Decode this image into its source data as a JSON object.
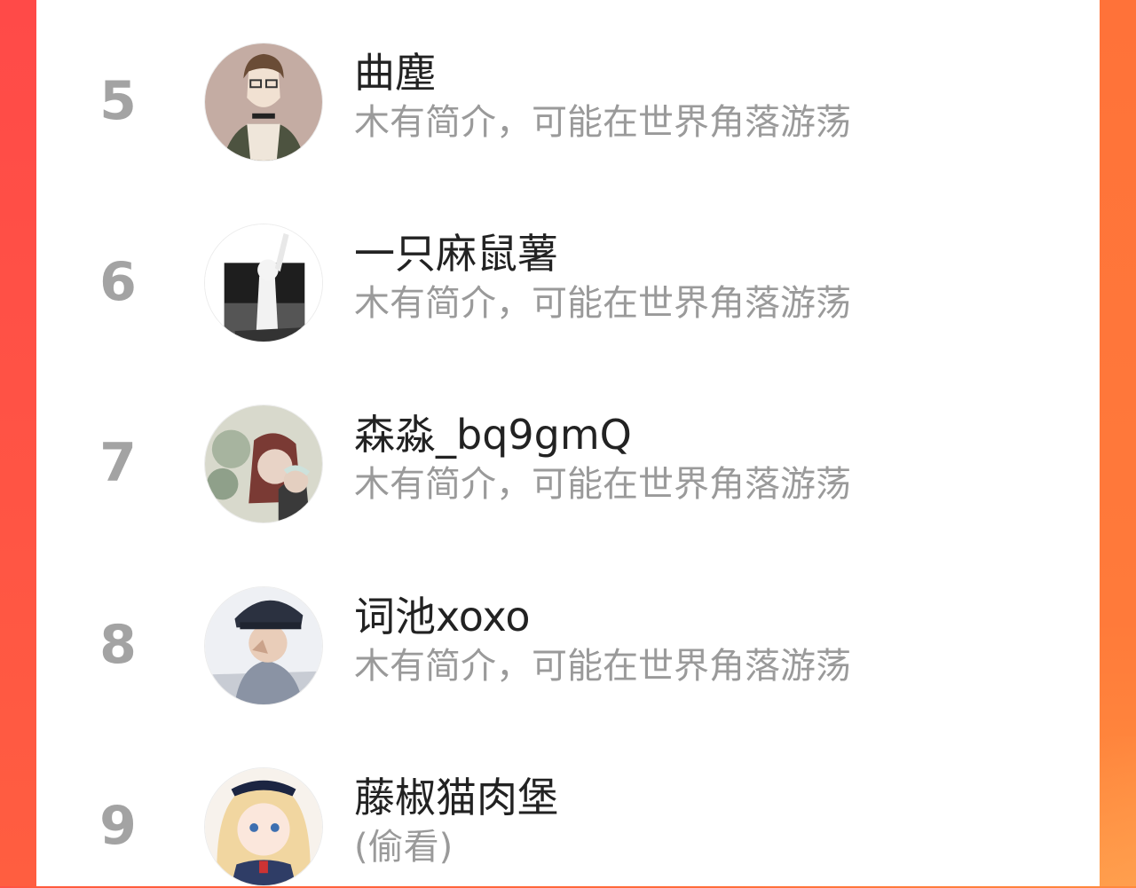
{
  "list": {
    "items": [
      {
        "rank": "5",
        "name": "曲塵",
        "bio": "木有简介，可能在世界角落游荡"
      },
      {
        "rank": "6",
        "name": "一只麻鼠薯",
        "bio": "木有简介，可能在世界角落游荡"
      },
      {
        "rank": "7",
        "name": "森淼_bq9gmQ",
        "bio": "木有简介，可能在世界角落游荡"
      },
      {
        "rank": "8",
        "name": "词池xoxo",
        "bio": "木有简介，可能在世界角落游荡"
      },
      {
        "rank": "9",
        "name": "藤椒猫肉堡",
        "bio": "(偷看)"
      }
    ]
  },
  "colors": {
    "background_left": "#ff4f46",
    "background_right": "#ff7a3a",
    "rank": "#a3a3a3",
    "name": "#222222",
    "bio": "#9a9a9a"
  }
}
